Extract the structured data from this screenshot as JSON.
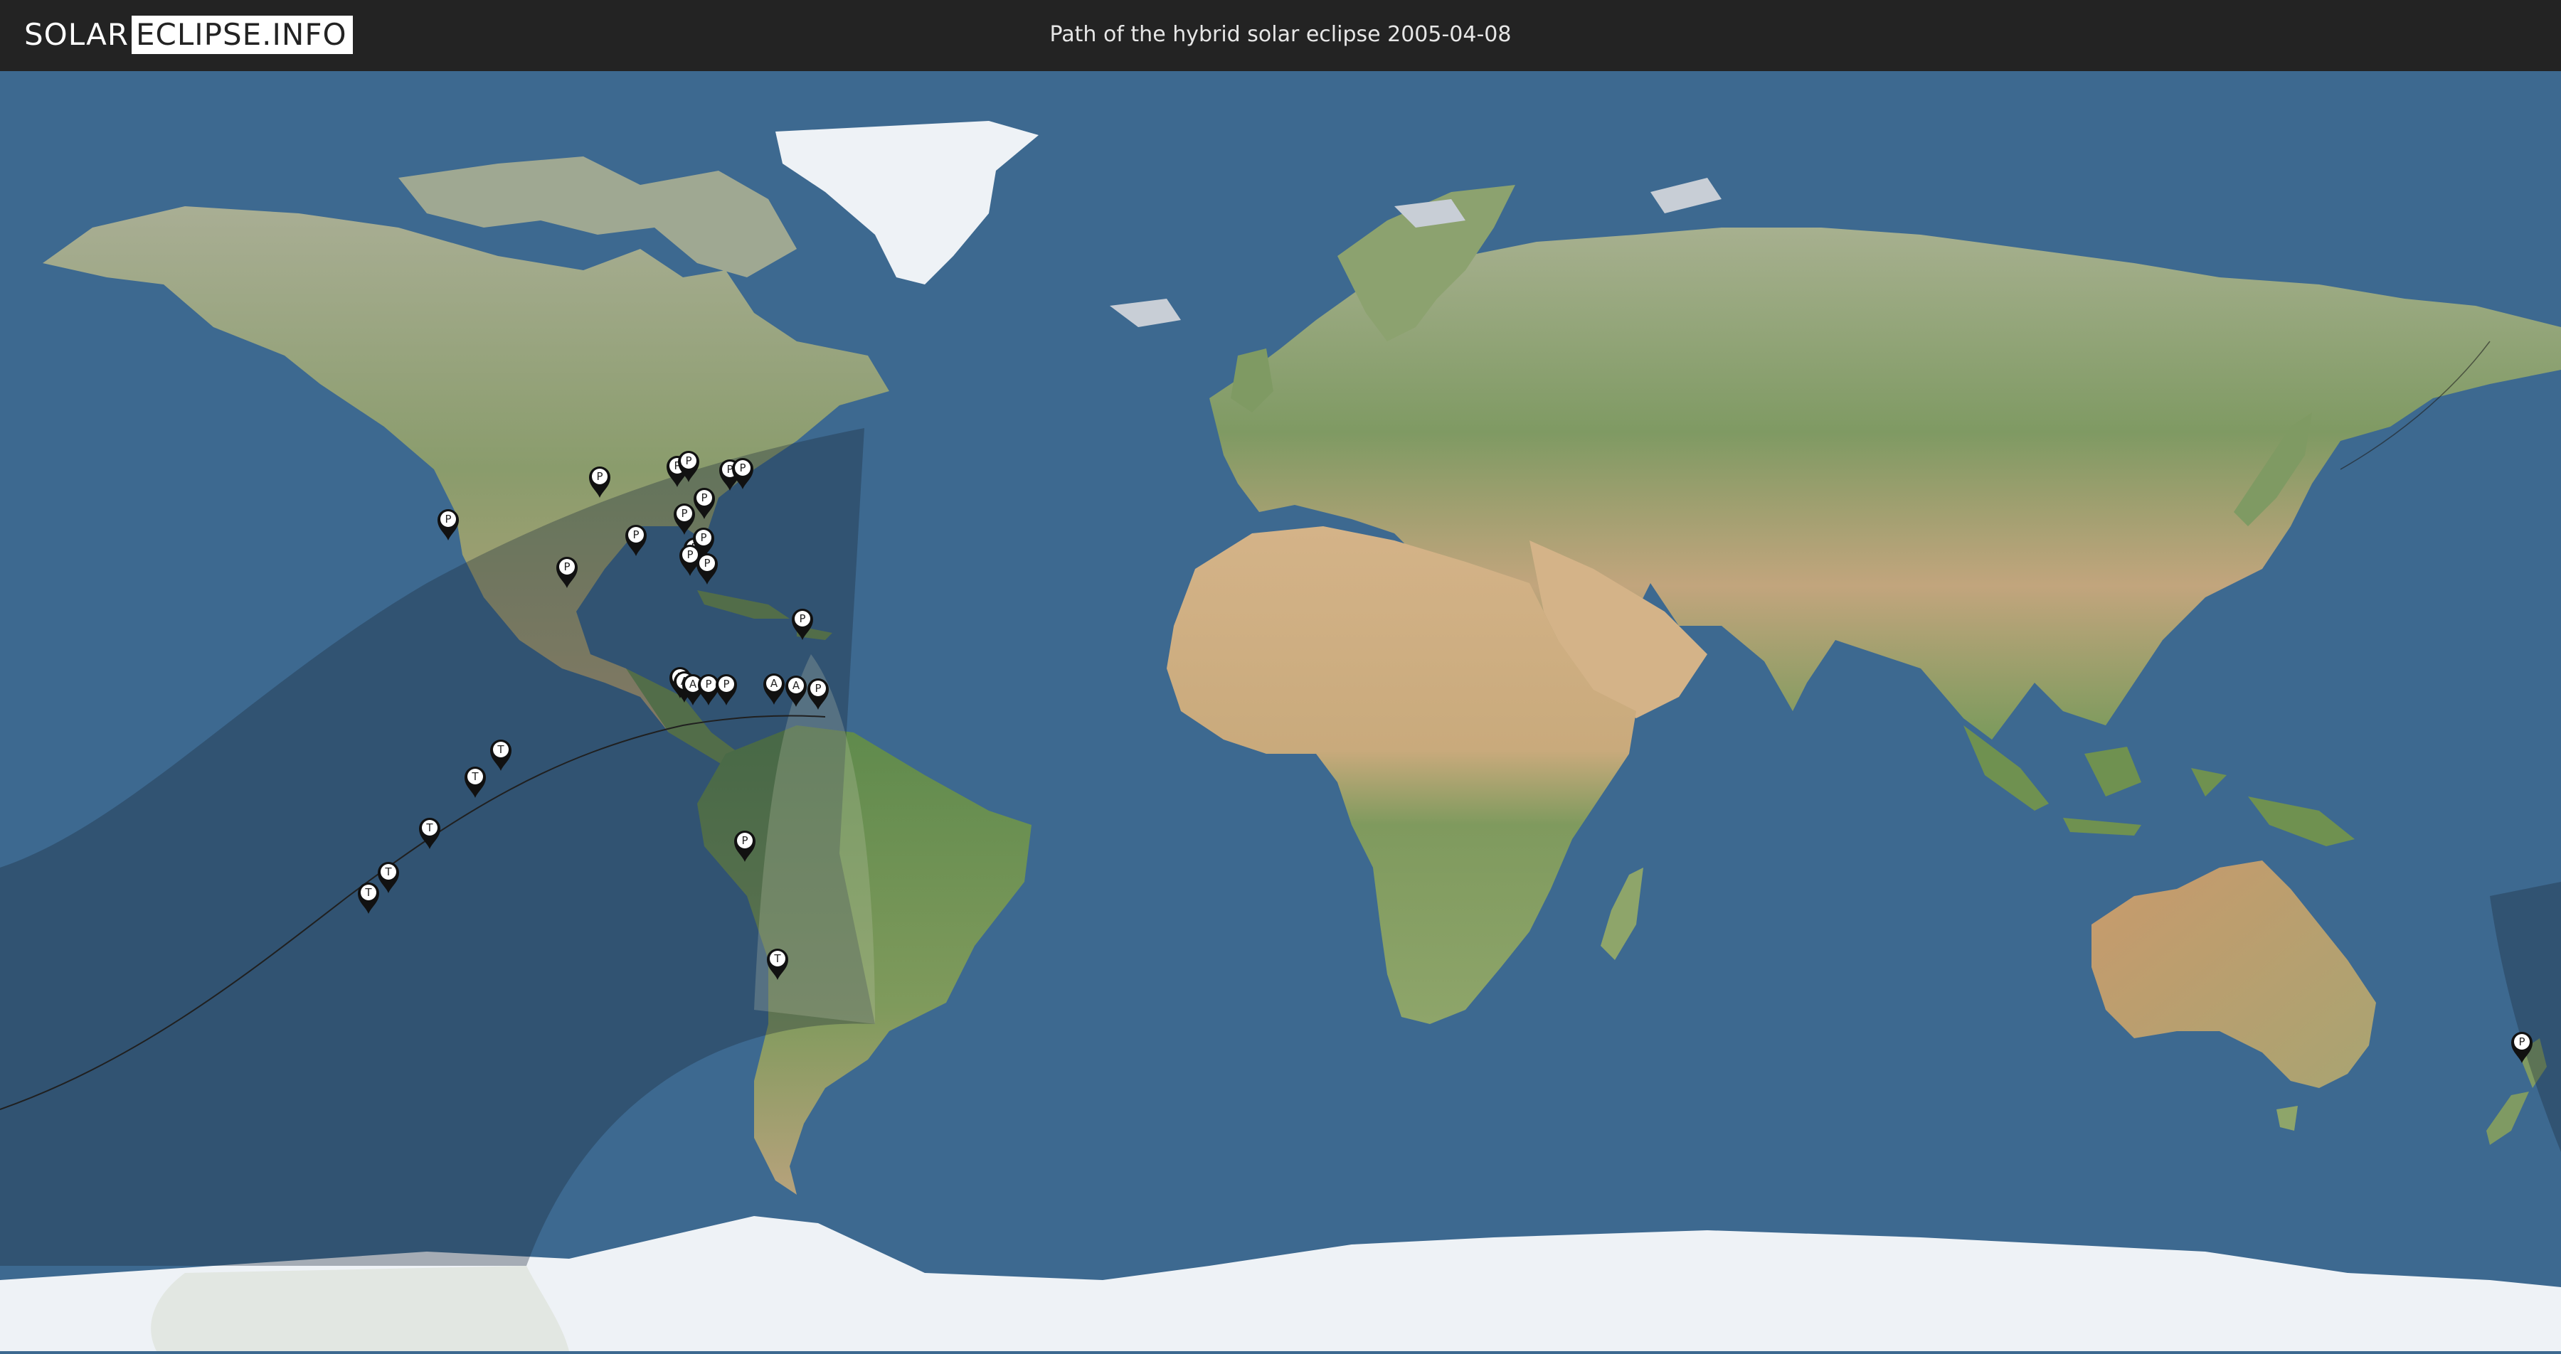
{
  "header": {
    "logo_part1": "SOLAR",
    "logo_part2": "ECLIPSE.INFO",
    "title": "Path of the hybrid solar eclipse 2005-04-08"
  },
  "colors": {
    "ocean": "#3d6990",
    "land": "#8a9c6c",
    "desert": "#c9aa7c",
    "ice": "#eef2f6",
    "eclipse_shadow": "#1e2a3c",
    "header_bg": "#232323"
  },
  "markers": [
    {
      "letter": "P"
    },
    {
      "letter": "P"
    },
    {
      "letter": "P"
    },
    {
      "letter": "P"
    },
    {
      "letter": "P"
    },
    {
      "letter": "P"
    },
    {
      "letter": "P"
    },
    {
      "letter": "P"
    },
    {
      "letter": "P"
    },
    {
      "letter": "P"
    },
    {
      "letter": "P"
    },
    {
      "letter": "P"
    },
    {
      "letter": "P"
    },
    {
      "letter": "P"
    },
    {
      "letter": "P"
    },
    {
      "letter": "P"
    },
    {
      "letter": "A"
    },
    {
      "letter": "A"
    },
    {
      "letter": "P"
    },
    {
      "letter": "P"
    },
    {
      "letter": "A"
    },
    {
      "letter": "A"
    },
    {
      "letter": "P"
    },
    {
      "letter": "P"
    },
    {
      "letter": "T"
    },
    {
      "letter": "T"
    },
    {
      "letter": "T"
    },
    {
      "letter": "T"
    },
    {
      "letter": "T"
    },
    {
      "letter": "T"
    },
    {
      "letter": "P"
    }
  ]
}
